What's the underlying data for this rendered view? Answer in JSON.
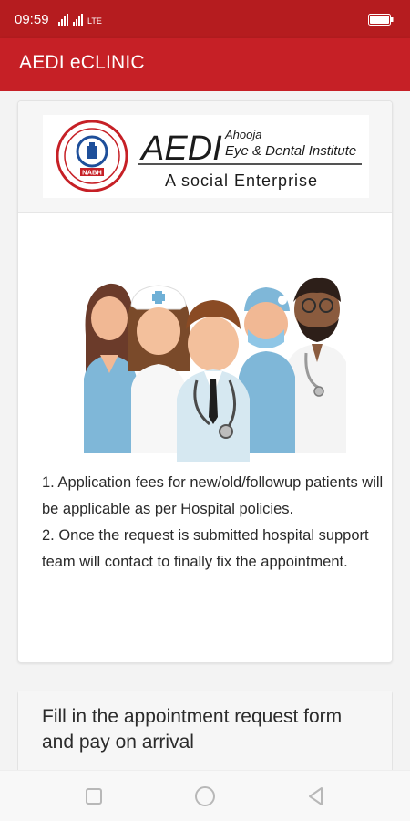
{
  "status_bar": {
    "time": "09:59",
    "network_label": "LTE"
  },
  "app_bar": {
    "title": "AEDI eCLINIC"
  },
  "logo": {
    "main": "AEDI",
    "line1": "Ahooja",
    "line2": "Eye & Dental Institute",
    "tagline": "A social Enterprise",
    "badge": "NABH"
  },
  "info": {
    "point1": "1. Application fees for new/old/followup patients will be applicable as per Hospital policies.",
    "point2": "2. Once the request is submitted hospital support team will contact to finally fix the appointment."
  },
  "form_card": {
    "title": "Fill in the appointment request form and pay on arrival"
  },
  "colors": {
    "app_bar": "#c62026",
    "status_bar": "#b51c1f"
  },
  "icons": {
    "signal": "signal-icon",
    "battery": "battery-icon",
    "recents": "square-icon",
    "home": "circle-icon",
    "back": "triangle-back-icon"
  }
}
